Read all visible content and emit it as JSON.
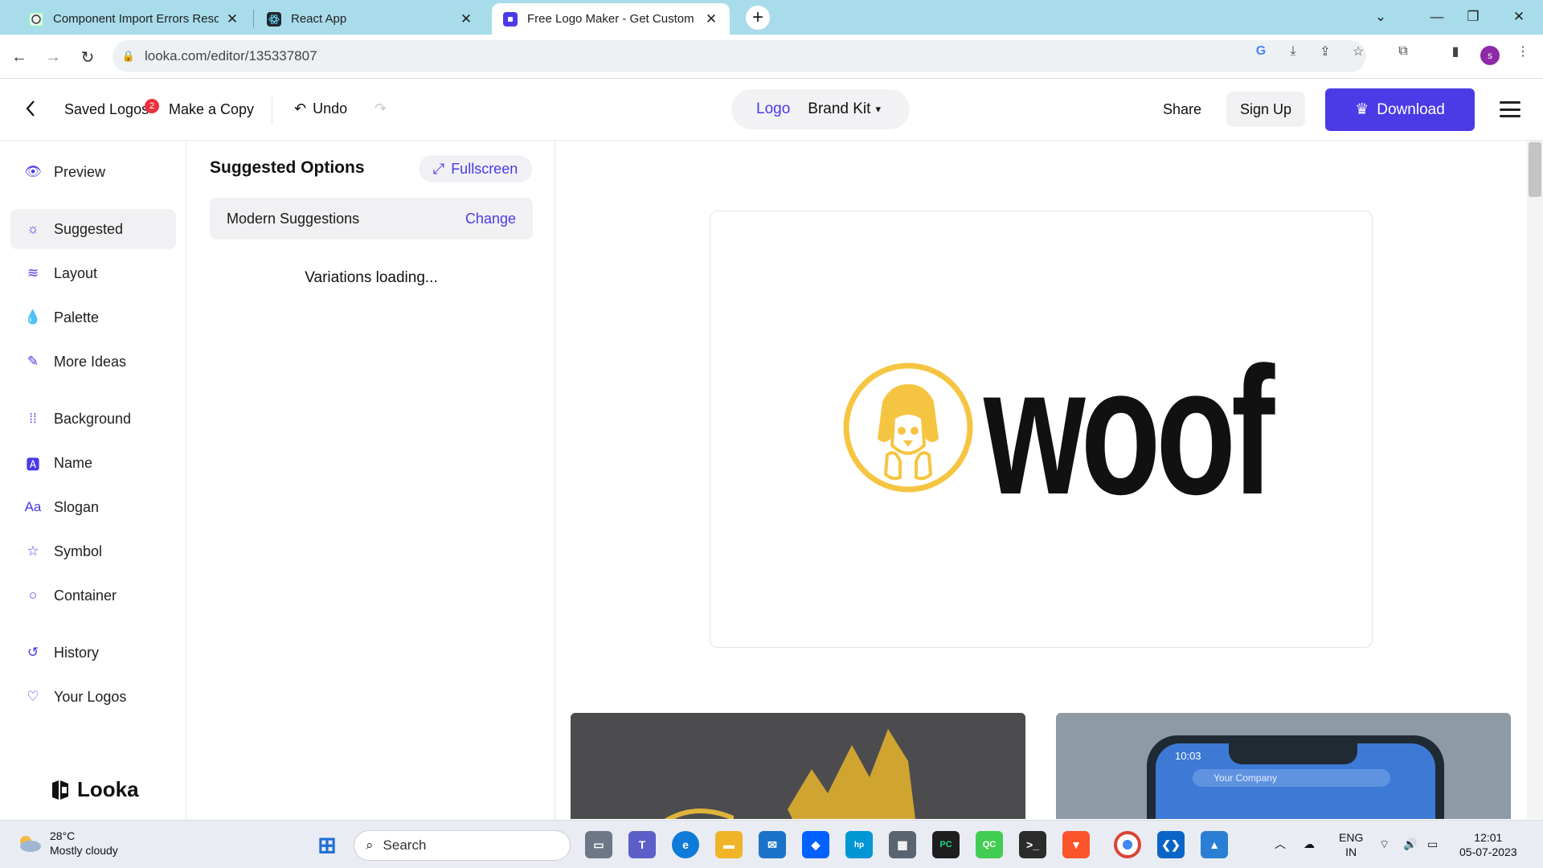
{
  "browser": {
    "tabs": [
      {
        "title": "Component Import Errors Resol",
        "icon": "chatgpt-icon"
      },
      {
        "title": "React App",
        "icon": "react-icon"
      },
      {
        "title": "Free Logo Maker - Get Custom",
        "icon": "looka-icon"
      }
    ],
    "new_tab": "+",
    "url": "looka.com/editor/135337807",
    "profile_initial": "s"
  },
  "header": {
    "back": "back-arrow-icon",
    "saved_logos": "Saved Logos",
    "saved_count": "2",
    "make_copy": "Make a Copy",
    "undo": "Undo",
    "tab_logo": "Logo",
    "tab_brand_kit": "Brand Kit",
    "share": "Share",
    "sign_up": "Sign Up",
    "download": "Download"
  },
  "sidebar": {
    "items": [
      {
        "label": "Preview",
        "icon": "eye-icon"
      },
      {
        "label": "Suggested",
        "icon": "bulb-icon"
      },
      {
        "label": "Layout",
        "icon": "layers-icon"
      },
      {
        "label": "Palette",
        "icon": "drop-icon"
      },
      {
        "label": "More Ideas",
        "icon": "magic-wand-icon"
      },
      {
        "label": "Background",
        "icon": "grid-icon"
      },
      {
        "label": "Name",
        "icon": "text-box-icon"
      },
      {
        "label": "Slogan",
        "icon": "font-icon"
      },
      {
        "label": "Symbol",
        "icon": "star-icon"
      },
      {
        "label": "Container",
        "icon": "circle-icon"
      },
      {
        "label": "History",
        "icon": "history-icon"
      },
      {
        "label": "Your Logos",
        "icon": "heart-icon"
      }
    ],
    "brand": "Looka"
  },
  "panel": {
    "title": "Suggested Options",
    "fullscreen": "Fullscreen",
    "suggestion_set": "Modern Suggestions",
    "change": "Change",
    "status": "Variations loading..."
  },
  "canvas": {
    "logo_text": "woof",
    "logo_color": "#111111",
    "icon_color": "#f5c542",
    "mockup_phone_time": "10:03",
    "mockup_phone_search": "Your Company"
  },
  "taskbar": {
    "temperature": "28°C",
    "weather": "Mostly cloudy",
    "search": "Search",
    "language": "ENG",
    "region": "IN",
    "time": "12:01",
    "date": "05-07-2023"
  },
  "colors": {
    "accent": "#4b3be6",
    "tabstrip": "#a8dceb"
  }
}
